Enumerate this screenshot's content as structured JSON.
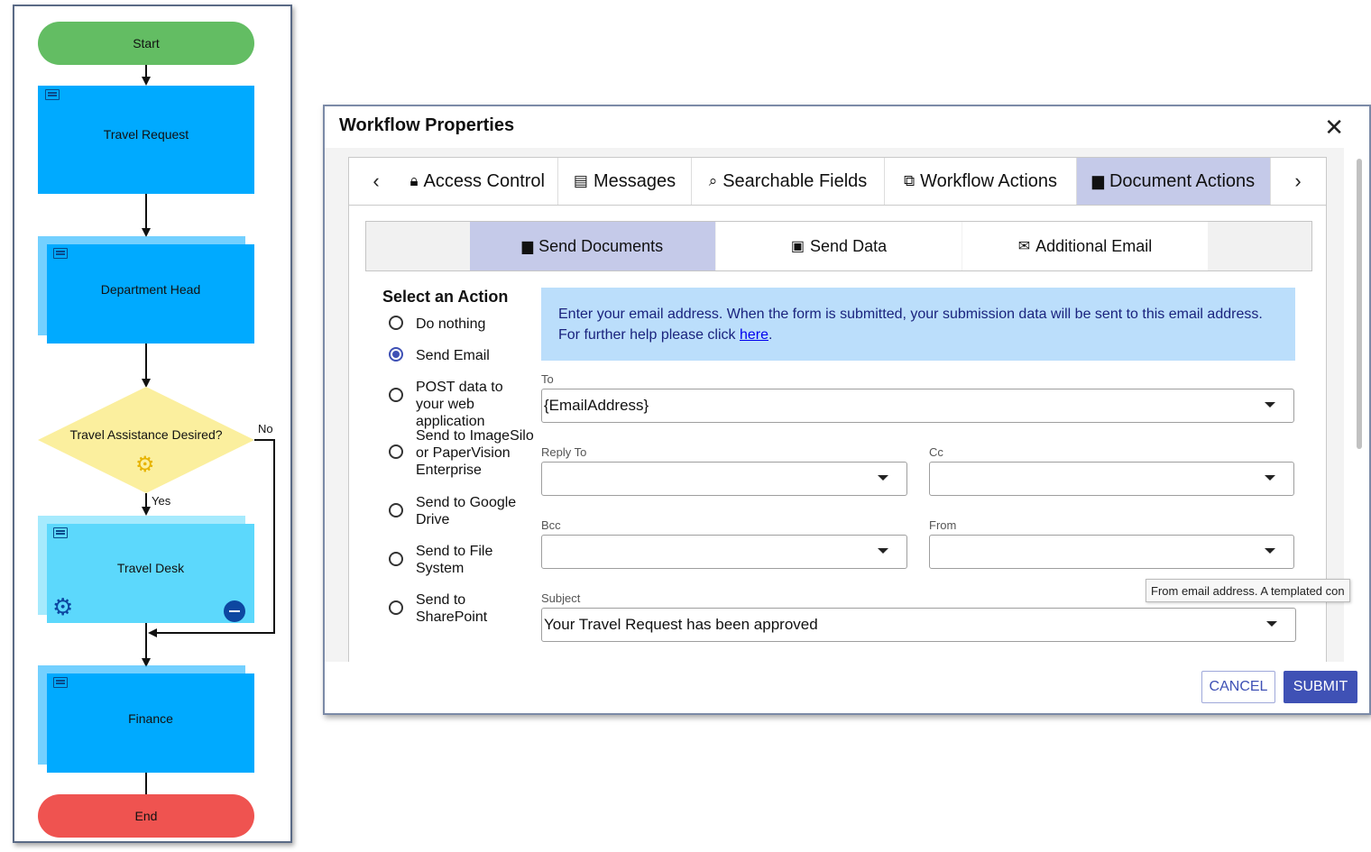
{
  "flowchart": {
    "nodes": {
      "start": "Start",
      "travel_request": "Travel Request",
      "department_head": "Department Head",
      "decision": "Travel Assistance Desired?",
      "travel_desk": "Travel Desk",
      "finance": "Finance",
      "end": "End"
    },
    "edges": {
      "yes": "Yes",
      "no": "No"
    },
    "colors": {
      "start": "#63bd63",
      "step": "#00aaff",
      "selected_step": "#5cd8fc",
      "decision": "#fbef9e",
      "end": "#ef5350",
      "edge": "#111111"
    }
  },
  "dialog": {
    "title": "Workflow Properties",
    "close_icon": "close-icon",
    "tabs": [
      {
        "label": "Access Control",
        "icon": "lock-icon"
      },
      {
        "label": "Messages",
        "icon": "message-icon"
      },
      {
        "label": "Searchable Fields",
        "icon": "search-icon"
      },
      {
        "label": "Workflow Actions",
        "icon": "external-link-icon"
      },
      {
        "label": "Document Actions",
        "icon": "document-icon",
        "active": true
      }
    ],
    "subtabs": [
      {
        "label": "Send Documents",
        "icon": "document-icon",
        "active": true
      },
      {
        "label": "Send Data",
        "icon": "save-icon"
      },
      {
        "label": "Additional Email",
        "icon": "mail-icon"
      }
    ],
    "select_action": {
      "title": "Select an Action",
      "options": [
        {
          "label": "Do nothing",
          "checked": false
        },
        {
          "label": "Send Email",
          "checked": true
        },
        {
          "label": "POST data to your web application",
          "checked": false
        },
        {
          "label": "Send to ImageSilo or PaperVision Enterprise",
          "checked": false
        },
        {
          "label": "Send to Google Drive",
          "checked": false
        },
        {
          "label": "Send to File System",
          "checked": false
        },
        {
          "label": "Send to SharePoint",
          "checked": false
        }
      ]
    },
    "info": {
      "line1": "Enter your email address. When the form is submitted, your submission data will be sent to this email address.",
      "line2_prefix": "For further help please click ",
      "link": "here",
      "line2_suffix": "."
    },
    "fields": {
      "to": {
        "label": "To",
        "value": "{EmailAddress}"
      },
      "reply_to": {
        "label": "Reply To",
        "value": ""
      },
      "cc": {
        "label": "Cc",
        "value": ""
      },
      "bcc": {
        "label": "Bcc",
        "value": ""
      },
      "from": {
        "label": "From",
        "value": ""
      },
      "subject": {
        "label": "Subject",
        "value": "Your Travel Request has been approved"
      }
    },
    "tooltip": "From email address.  A templated con",
    "buttons": {
      "cancel": "CANCEL",
      "submit": "SUBMIT"
    },
    "colors": {
      "accent": "#3f51b5",
      "active_tab": "#c5cae9",
      "info_bg": "#bbdefb"
    }
  }
}
